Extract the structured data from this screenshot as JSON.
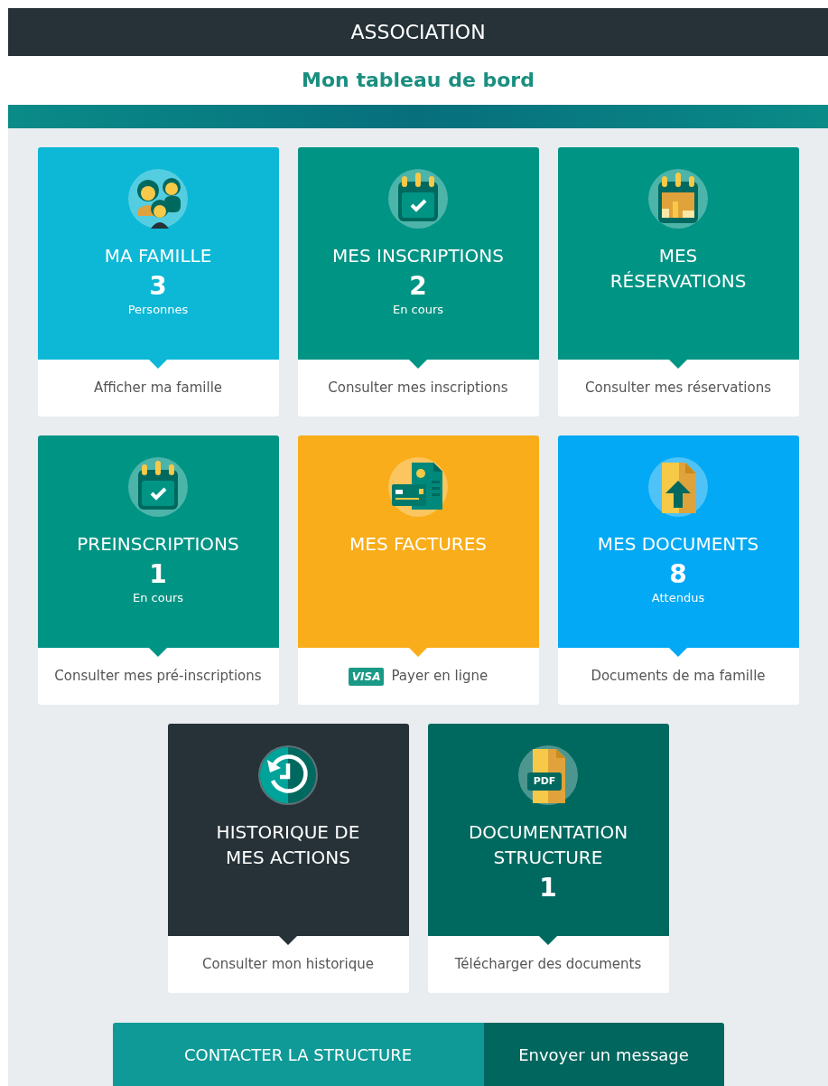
{
  "header": {
    "title": "ASSOCIATION"
  },
  "subtitle": "Mon tableau de bord",
  "rows": [
    [
      {
        "kind": "family",
        "color": "#0cb8d5",
        "title": [
          "MA FAMILLE"
        ],
        "count": "3",
        "count_label": "Personnes",
        "link": "Afficher ma famille"
      },
      {
        "kind": "calendar_check",
        "color": "#009484",
        "title": [
          "MES INSCRIPTIONS"
        ],
        "count": "2",
        "count_label": "En cours",
        "link": "Consulter mes inscriptions"
      },
      {
        "kind": "calendar_chart",
        "color": "#009484",
        "title": [
          "MES",
          "RÉSERVATIONS"
        ],
        "link": "Consulter mes réservations"
      }
    ],
    [
      {
        "kind": "calendar_check",
        "color": "#009484",
        "title": [
          "PREINSCRIPTIONS"
        ],
        "count": "1",
        "count_label": "En cours",
        "link": "Consulter mes pré-inscriptions"
      },
      {
        "kind": "invoice",
        "color": "#f9ad1a",
        "title": [
          "MES FACTURES"
        ],
        "link_badge": "VISA",
        "link": "Payer en ligne"
      },
      {
        "kind": "document_upload",
        "color": "#03a9f4",
        "title": [
          "MES DOCUMENTS"
        ],
        "count": "8",
        "count_label": "Attendus",
        "link": "Documents de ma famille"
      }
    ],
    [
      {
        "kind": "history",
        "color": "#263238",
        "title": [
          "HISTORIQUE DE",
          "MES ACTIONS"
        ],
        "link": "Consulter mon historique"
      },
      {
        "kind": "pdf",
        "icon_text": "PDF",
        "color": "#00695f",
        "title": [
          "DOCUMENTATION",
          "STRUCTURE"
        ],
        "count": "1",
        "link": "Télécharger des documents"
      }
    ]
  ],
  "contact": {
    "label": "CONTACTER LA STRUCTURE",
    "action": "Envoyer un message"
  }
}
